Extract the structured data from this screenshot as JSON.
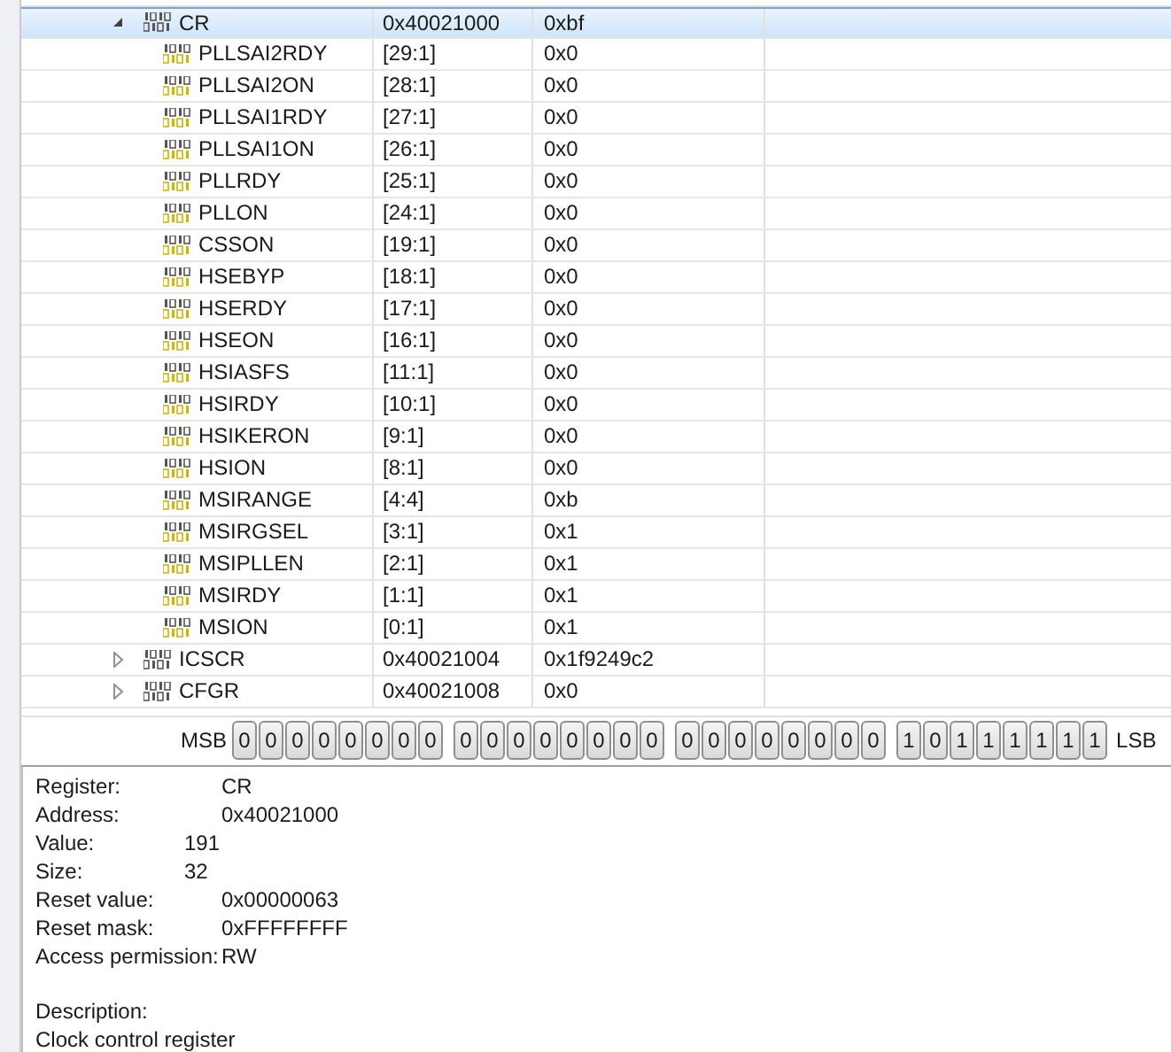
{
  "registers": [
    {
      "name": "CR",
      "address": "0x40021000",
      "value": "0xbf",
      "expanded": true,
      "selected": true,
      "children": [
        {
          "name": "PLLSAI2RDY",
          "address": "[29:1]",
          "value": "0x0"
        },
        {
          "name": "PLLSAI2ON",
          "address": "[28:1]",
          "value": "0x0"
        },
        {
          "name": "PLLSAI1RDY",
          "address": "[27:1]",
          "value": "0x0"
        },
        {
          "name": "PLLSAI1ON",
          "address": "[26:1]",
          "value": "0x0"
        },
        {
          "name": "PLLRDY",
          "address": "[25:1]",
          "value": "0x0"
        },
        {
          "name": "PLLON",
          "address": "[24:1]",
          "value": "0x0"
        },
        {
          "name": "CSSON",
          "address": "[19:1]",
          "value": "0x0"
        },
        {
          "name": "HSEBYP",
          "address": "[18:1]",
          "value": "0x0"
        },
        {
          "name": "HSERDY",
          "address": "[17:1]",
          "value": "0x0"
        },
        {
          "name": "HSEON",
          "address": "[16:1]",
          "value": "0x0"
        },
        {
          "name": "HSIASFS",
          "address": "[11:1]",
          "value": "0x0"
        },
        {
          "name": "HSIRDY",
          "address": "[10:1]",
          "value": "0x0"
        },
        {
          "name": "HSIKERON",
          "address": "[9:1]",
          "value": "0x0"
        },
        {
          "name": "HSION",
          "address": "[8:1]",
          "value": "0x0"
        },
        {
          "name": "MSIRANGE",
          "address": "[4:4]",
          "value": "0xb"
        },
        {
          "name": "MSIRGSEL",
          "address": "[3:1]",
          "value": "0x1"
        },
        {
          "name": "MSIPLLEN",
          "address": "[2:1]",
          "value": "0x1"
        },
        {
          "name": "MSIRDY",
          "address": "[1:1]",
          "value": "0x1"
        },
        {
          "name": "MSION",
          "address": "[0:1]",
          "value": "0x1"
        }
      ]
    },
    {
      "name": "ICSCR",
      "address": "0x40021004",
      "value": "0x1f9249c2",
      "expanded": false,
      "selected": false
    },
    {
      "name": "CFGR",
      "address": "0x40021008",
      "value": "0x0",
      "expanded": false,
      "selected": false
    }
  ],
  "bits": {
    "msb_label": "MSB",
    "lsb_label": "LSB",
    "groups": [
      [
        "0",
        "0",
        "0",
        "0",
        "0",
        "0",
        "0",
        "0"
      ],
      [
        "0",
        "0",
        "0",
        "0",
        "0",
        "0",
        "0",
        "0"
      ],
      [
        "0",
        "0",
        "0",
        "0",
        "0",
        "0",
        "0",
        "0"
      ],
      [
        "1",
        "0",
        "1",
        "1",
        "1",
        "1",
        "1",
        "1"
      ]
    ]
  },
  "details": [
    {
      "label": "Register:",
      "value": "CR",
      "kind": "text"
    },
    {
      "label": "Address:",
      "value": "0x40021000",
      "kind": "text"
    },
    {
      "label": "Value:",
      "value": "191",
      "kind": "number"
    },
    {
      "label": "Size:",
      "value": "32",
      "kind": "number"
    },
    {
      "label": "Reset value:",
      "value": "0x00000063",
      "kind": "text"
    },
    {
      "label": "Reset mask:",
      "value": "0xFFFFFFFF",
      "kind": "text"
    },
    {
      "label": "Access permission:",
      "value": "RW",
      "kind": "text"
    }
  ],
  "description": {
    "label": "Description:",
    "text": "Clock control register"
  }
}
